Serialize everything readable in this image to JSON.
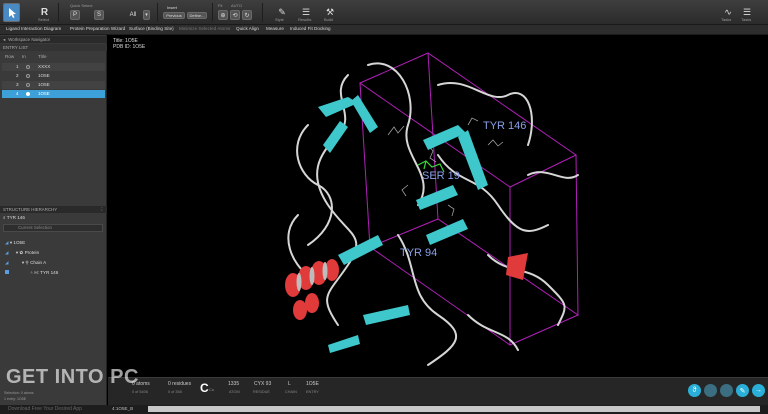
{
  "toolbar": {
    "select_label": "R",
    "select_sub": "Select",
    "pick_group": "Quick Select",
    "pick_p": "P",
    "pick_s": "S",
    "pick_all": "All",
    "insert_label": "Insert",
    "previous_label": "Previous",
    "define_label": "Define...",
    "fit_label": "Fit",
    "auto_label": "AUTO",
    "btn_labels": [
      "Style",
      "Results",
      "Build"
    ],
    "right_labels": [
      "Tasks",
      "Tasks",
      "Tasks"
    ]
  },
  "tasks": [
    {
      "label": "Ligand Interaction Diagram",
      "dim": false
    },
    {
      "label": "Protein Preparation Wizard",
      "dim": false
    },
    {
      "label": "Surface (Binding Site)",
      "dim": false
    },
    {
      "label": "Minimize Selected Atoms",
      "dim": true
    },
    {
      "label": "Quick Align",
      "dim": false
    },
    {
      "label": "Measure",
      "dim": false
    },
    {
      "label": "Induced Fit Docking",
      "dim": false
    }
  ],
  "navigator": {
    "title": "Workspace Navigator",
    "entry_list": "ENTRY LIST",
    "columns": [
      "Row",
      "In",
      "Title"
    ],
    "entries": [
      {
        "row": "1",
        "title": "XXXX",
        "selected": false
      },
      {
        "row": "2",
        "title": "1O5E",
        "selected": false
      },
      {
        "row": "3",
        "title": "1O5E",
        "selected": false
      },
      {
        "row": "4",
        "title": "1O5E",
        "selected": true
      }
    ]
  },
  "hierarchy": {
    "title": "STRUCTURE HIERARCHY",
    "current": "TYR 146",
    "search_placeholder": "Current Selection",
    "items": [
      "1O5E",
      "Protein",
      "Chain A",
      "H: TYR 146"
    ]
  },
  "viewer": {
    "title_line": "Title: 1O5E",
    "pdb_line": "PDB ID: 1O5E",
    "labels": [
      "TYR 146",
      "SER 19",
      "TYR 94"
    ]
  },
  "status": {
    "atoms_count": "0 atoms",
    "atoms_of": "0 of 5406",
    "residues_count": "0 residues",
    "residues_of": "0 of 358",
    "element": "C",
    "element_sub": "Ca",
    "atom_num": "1335",
    "atom_lbl": "ATOM",
    "residue": "CYX 93",
    "residue_lbl": "RESIDUE",
    "chain": "L",
    "chain_lbl": "CHAIN",
    "entry": "1O5E",
    "entry_lbl": "ENTRY",
    "selection_info": "Selection: 0 atoms",
    "selection_info2": "1 entry: 1O5E"
  },
  "bottom": {
    "text1": "Download Free Your Desired App",
    "text2": "4:1O5E_B"
  },
  "watermark": "GET INTO PC",
  "colors": {
    "ribbon": "#3fc8cc",
    "helix": "#e03a3a",
    "coil": "#d6d6d6",
    "box": "#b020b8",
    "label": "#8aa0e8",
    "selection": "#3da0d8"
  }
}
